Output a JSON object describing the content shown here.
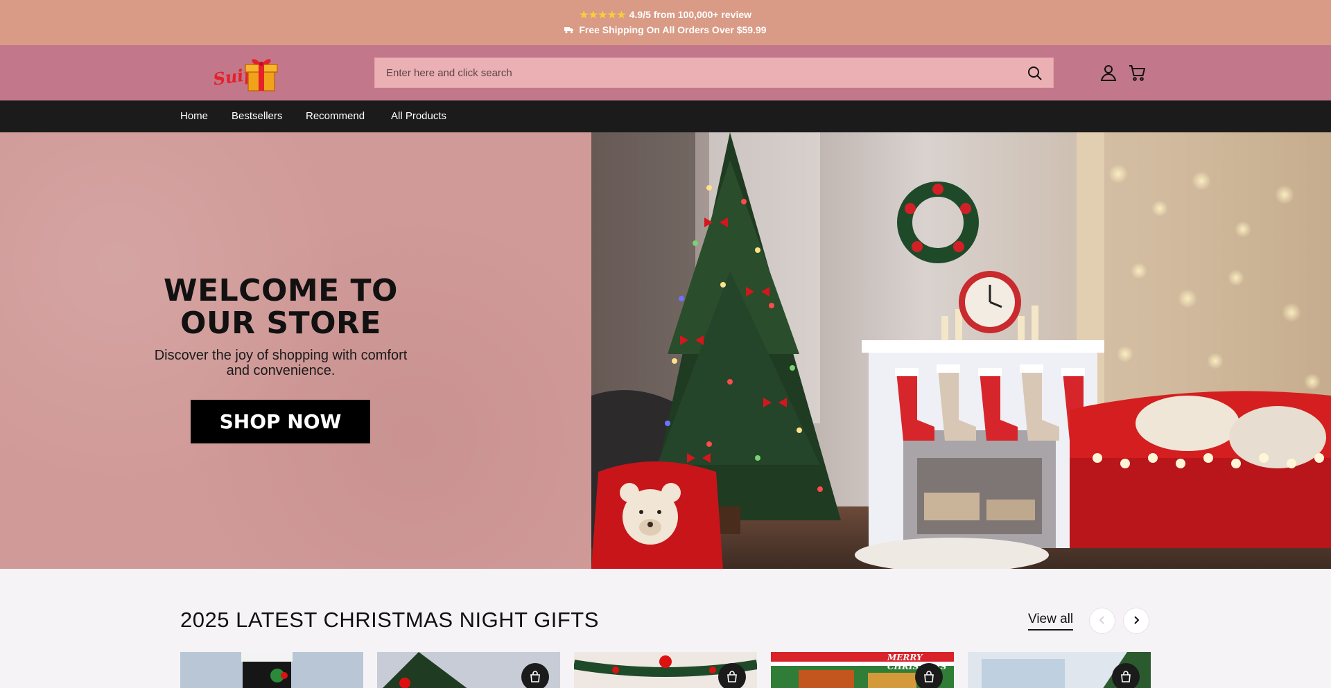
{
  "announcement": {
    "stars": "★★★★★",
    "rating_text": "4.9/5 from 100,000+ review",
    "shipping_icon": "truck-icon",
    "shipping_text": "Free Shipping On All Orders Over $59.99"
  },
  "header": {
    "logo_text": "Suipc",
    "search_placeholder": "Enter here and click search",
    "search_value": "",
    "icons": [
      "search-icon",
      "account-icon",
      "cart-icon"
    ]
  },
  "nav": {
    "items": [
      {
        "label": "Home"
      },
      {
        "label": "Bestsellers"
      },
      {
        "label": "Recommend"
      },
      {
        "label": "All Products"
      }
    ]
  },
  "hero": {
    "title": "WELCOME TO OUR STORE",
    "subtitle": "Discover the joy of shopping with comfort and convenience.",
    "cta": "SHOP NOW"
  },
  "collection": {
    "title": "2025 LATEST CHRISTMAS NIGHT GIFTS",
    "view_all": "View all",
    "card_banner_text": "MERRY CHRISTMAS",
    "cards": [
      {
        "name": "product-card-1"
      },
      {
        "name": "product-card-2"
      },
      {
        "name": "product-card-3"
      },
      {
        "name": "product-card-4"
      },
      {
        "name": "product-card-5"
      }
    ]
  },
  "colors": {
    "announcement_bg": "#d99b86",
    "header_bg": "#c2788a",
    "search_bg": "#ebb0b3",
    "nav_bg": "#1b1b1b",
    "hero_left_bg": "#d09a98",
    "cta_bg": "#000000"
  }
}
